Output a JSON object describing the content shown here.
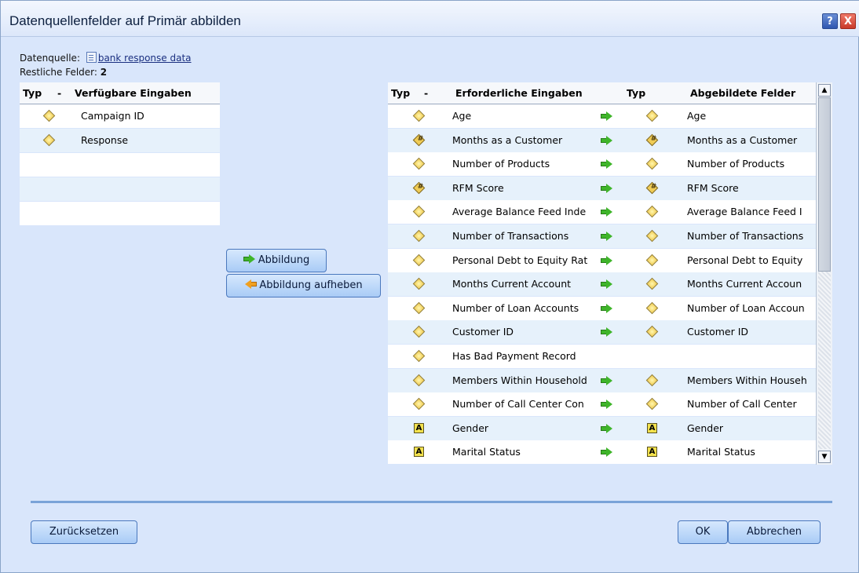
{
  "window": {
    "title": "Datenquellenfelder auf Primär abbilden",
    "help_label": "?",
    "close_label": "X"
  },
  "source": {
    "label": "Datenquelle:",
    "name": "bank response data"
  },
  "remaining": {
    "label": "Restliche Felder:",
    "count": "2"
  },
  "available": {
    "header_type": "Typ",
    "header_sort": "-",
    "header_name": "Verfügbare Eingaben",
    "rows": [
      {
        "icon": "continuous-diamond-icon",
        "name": "Campaign ID"
      },
      {
        "icon": "continuous-diamond-icon",
        "name": "Response"
      }
    ]
  },
  "buttons": {
    "map": "Abbildung",
    "unmap": "Abbildung aufheben",
    "reset": "Zurücksetzen",
    "ok": "OK",
    "cancel": "Abbrechen"
  },
  "required": {
    "header_type": "Typ",
    "header_sort": "-",
    "header_name": "Erforderliche Eingaben",
    "header_type2": "Typ",
    "header_mapped": "Abgebildete Felder",
    "rows": [
      {
        "icon": "diamond",
        "name": "Age",
        "mapped": true,
        "micon": "diamond",
        "mapped_name": "Age"
      },
      {
        "icon": "ordinal",
        "name": "Months as a Customer",
        "mapped": true,
        "micon": "ordinal",
        "mapped_name": "Months as a Customer"
      },
      {
        "icon": "diamond",
        "name": "Number of Products",
        "mapped": true,
        "micon": "diamond",
        "mapped_name": "Number of Products"
      },
      {
        "icon": "ordinal",
        "name": "RFM Score",
        "mapped": true,
        "micon": "ordinal",
        "mapped_name": "RFM Score"
      },
      {
        "icon": "diamond",
        "name": "Average Balance Feed Inde",
        "mapped": true,
        "micon": "diamond",
        "mapped_name": "Average Balance Feed I"
      },
      {
        "icon": "diamond",
        "name": "Number of Transactions",
        "mapped": true,
        "micon": "diamond",
        "mapped_name": "Number of Transactions"
      },
      {
        "icon": "diamond",
        "name": "Personal Debt to Equity Rat",
        "mapped": true,
        "micon": "diamond",
        "mapped_name": "Personal Debt to Equity"
      },
      {
        "icon": "diamond",
        "name": "Months Current Account",
        "mapped": true,
        "micon": "diamond",
        "mapped_name": "Months Current Accoun"
      },
      {
        "icon": "diamond",
        "name": "Number of Loan Accounts",
        "mapped": true,
        "micon": "diamond",
        "mapped_name": "Number of Loan Accoun"
      },
      {
        "icon": "diamond",
        "name": "Customer ID",
        "mapped": true,
        "micon": "diamond",
        "mapped_name": "Customer ID"
      },
      {
        "icon": "diamond",
        "name": "Has Bad Payment Record",
        "mapped": false,
        "micon": "",
        "mapped_name": ""
      },
      {
        "icon": "diamond",
        "name": "Members Within Household",
        "mapped": true,
        "micon": "diamond",
        "mapped_name": "Members Within Househ"
      },
      {
        "icon": "diamond",
        "name": "Number of Call Center Con",
        "mapped": true,
        "micon": "diamond",
        "mapped_name": "Number of Call Center"
      },
      {
        "icon": "typeA",
        "name": "Gender",
        "mapped": true,
        "micon": "typeA",
        "mapped_name": "Gender"
      },
      {
        "icon": "typeA",
        "name": "Marital Status",
        "mapped": true,
        "micon": "typeA",
        "mapped_name": "Marital Status"
      }
    ]
  },
  "scroll": {
    "up": "▲",
    "down": "▼"
  }
}
